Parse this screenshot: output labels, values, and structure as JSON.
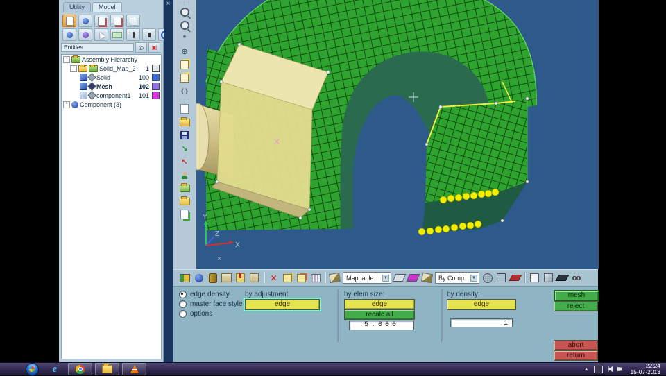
{
  "left_panel": {
    "tabs": [
      {
        "label": "Utility"
      },
      {
        "label": "Model"
      }
    ],
    "entities_header": {
      "label": "Entities"
    },
    "tree": {
      "root_label": "Assembly Hierarchy",
      "items": [
        {
          "label": "Solid_Map_2",
          "count": "1"
        },
        {
          "label": "Solid",
          "count": "100"
        },
        {
          "label": "Mesh",
          "count": "102"
        },
        {
          "label": "component1",
          "count": "101"
        }
      ],
      "component_label": "Component (3)"
    }
  },
  "glyphs": {
    "close": "×",
    "minus": "−",
    "plus": "+",
    "dropdown": "▼",
    "asterisk": "*",
    "braces": "{ }",
    "arrow_se": "↘",
    "arrow_nw": "↖",
    "delete_x": "✕",
    "glasses": "oo",
    "tray_expand": "▲",
    "grip": "· · · ·",
    "ie_letter": "e"
  },
  "toolbar_bottom": {
    "mappable_value": "Mappable",
    "bycomp_value": "By Comp"
  },
  "viewport": {
    "axis": {
      "x": "X",
      "y": "Y",
      "z": "Z",
      "extra_glyph": "×"
    }
  },
  "panel": {
    "radios": [
      {
        "label": "edge density",
        "selected": true
      },
      {
        "label": "master face style",
        "selected": false
      },
      {
        "label": "options",
        "selected": false
      }
    ],
    "col_adjustment": {
      "label": "by adjustment",
      "edge_button": "edge"
    },
    "col_elemsize": {
      "label": "by elem size:",
      "edge_button": "edge",
      "recalc_button": "recalc all",
      "value": "5.000"
    },
    "col_density": {
      "label": "by density:",
      "edge_button": "edge",
      "value": "1"
    },
    "actions": {
      "mesh": "mesh",
      "reject": "reject",
      "abort": "abort",
      "return": "return"
    }
  },
  "taskbar": {
    "clock": {
      "time": "22:24",
      "date": "15-07-2013"
    }
  },
  "colors": {
    "viewport_bg": "#2d5a8a",
    "mesh_green": "#2fa32f",
    "mesh_line": "#0f4d0e",
    "mesh_dark_face": "#2a6b50",
    "leg_bottom_dark": "#1f5a42",
    "solid_yellow": "#e2dc8e",
    "solid_top": "#ece5ad",
    "solid_bottom": "#c2b67c",
    "node_yellow": "#f2ee00",
    "left_panel_bg": "#b9cfdd",
    "strip_bg": "#a9c2d0",
    "panel_bg": "#8fb4c4",
    "btn_yellow": "#e6e44e",
    "btn_green": "#43ae49",
    "btn_red": "#c95553",
    "selected_border": "#7cf7d4",
    "swatch_solid": "#e8e8ea",
    "swatch_blue": "#3a6cd8",
    "swatch_mesh": "#9070e8",
    "swatch_comp": "#e030e0",
    "taskbar_bg": "#332a52",
    "taskbar_hi": "#4d4472"
  }
}
